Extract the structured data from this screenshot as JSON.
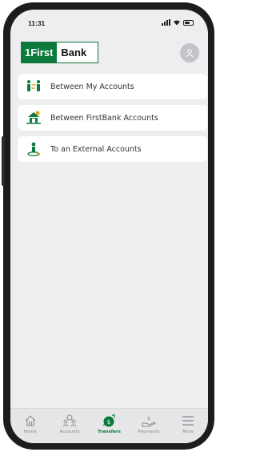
{
  "status_bar": {
    "time": "11:31"
  },
  "logo": {
    "part1": "1First",
    "part2": "Bank"
  },
  "menu": {
    "items": [
      {
        "label": "Between My Accounts",
        "icon": "transfer-people-icon"
      },
      {
        "label": "Between FirstBank Accounts",
        "icon": "bank-transfer-icon"
      },
      {
        "label": "To an External Accounts",
        "icon": "external-transfer-icon"
      }
    ]
  },
  "tabbar": {
    "items": [
      {
        "label": "Home",
        "icon": "home-icon"
      },
      {
        "label": "Accounts",
        "icon": "accounts-icon"
      },
      {
        "label": "Transfers",
        "icon": "transfers-icon",
        "active": true
      },
      {
        "label": "Payments",
        "icon": "payments-icon"
      },
      {
        "label": "More",
        "icon": "menu-icon"
      }
    ]
  },
  "colors": {
    "brand_green": "#0b7a3c",
    "background": "#eeeef0",
    "inactive": "#8a8a8e"
  }
}
